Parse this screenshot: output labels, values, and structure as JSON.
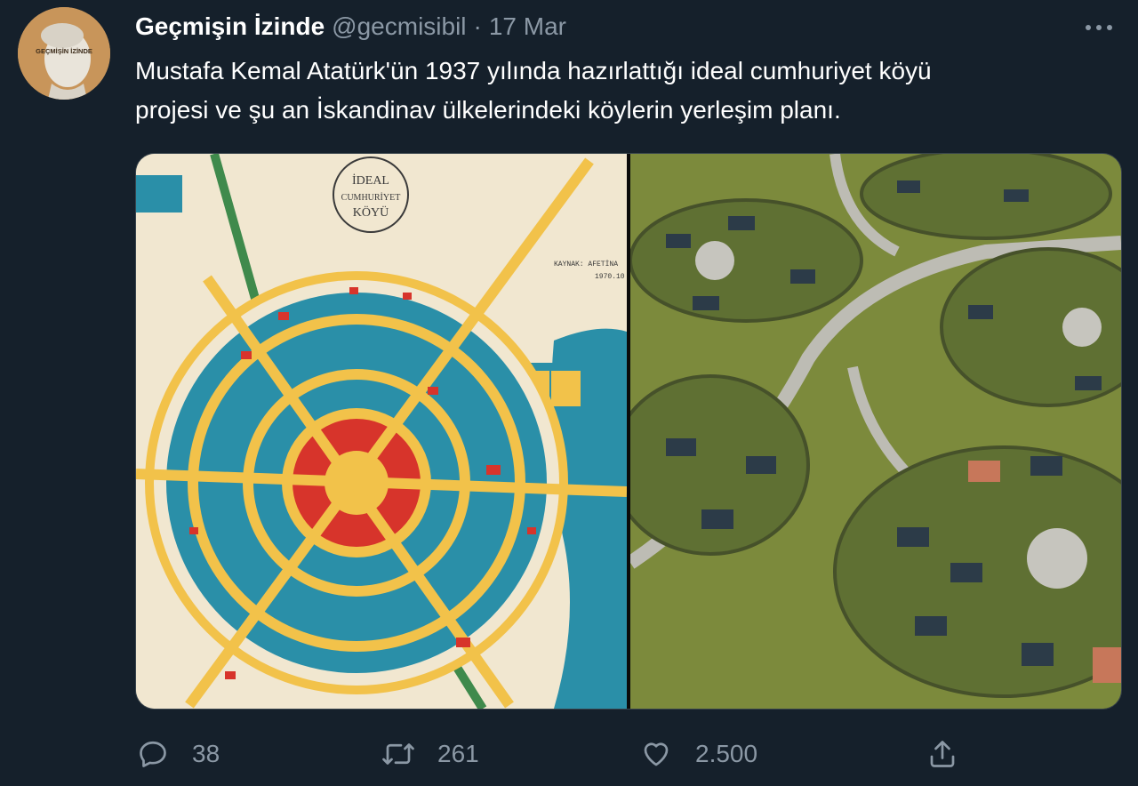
{
  "tweet": {
    "author_name": "Geçmişin İzinde",
    "author_handle": "@gecmisibil",
    "separator": "·",
    "timestamp": "17 Mar",
    "avatar_text": "GEÇMİŞİN İZİNDE",
    "text_line1": "Mustafa Kemal Atatürk'ün 1937 yılında hazırlattığı ideal cumhuriyet köyü",
    "text_line2": "projesi ve şu an İskandinav ülkelerindeki köylerin yerleşim planı."
  },
  "media": {
    "map_title_line1": "İDEAL",
    "map_title_line2": "CUMHURİYET",
    "map_title_line3": "KÖYÜ",
    "map_source_line1": "KAYNAK: AFETİNA",
    "map_source_line2": "1970.10"
  },
  "actions": {
    "reply_count": "38",
    "retweet_count": "261",
    "like_count": "2.500"
  },
  "icons": {
    "reply": "reply-icon",
    "retweet": "retweet-icon",
    "like": "heart-icon",
    "share": "share-icon",
    "more": "more-options-icon"
  },
  "colors": {
    "background": "#15202b",
    "text_primary": "#ffffff",
    "text_secondary": "#8b98a5",
    "map_teal": "#2a8fa8",
    "map_yellow": "#f2c24a",
    "map_red": "#d7342b",
    "map_paper": "#f1e7d0",
    "photo_grass": "#7c8a3c"
  }
}
